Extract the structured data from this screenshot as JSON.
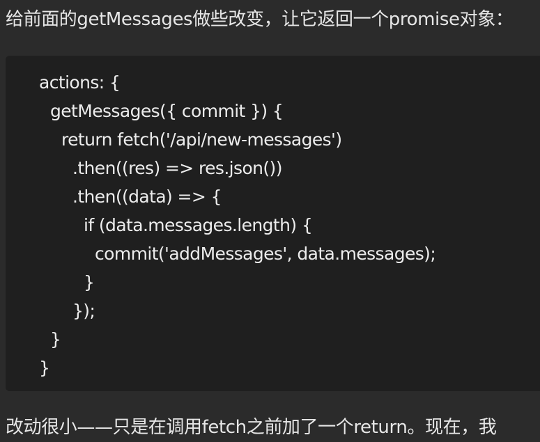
{
  "intro_text": "给前面的getMessages做些改变，让它返回一个promise对象：",
  "code_lines": [
    "actions: {",
    "getMessages({ commit }) {",
    "return fetch('/api/new-messages')",
    ".then((res) => res.json())",
    ".then((data) => {",
    "if (data.messages.length) {",
    "commit('addMessages', data.messages);",
    "}",
    "});",
    "}",
    "}"
  ],
  "followup_text": "改动很小——只是在调用fetch之前加了一个return。现在，我"
}
